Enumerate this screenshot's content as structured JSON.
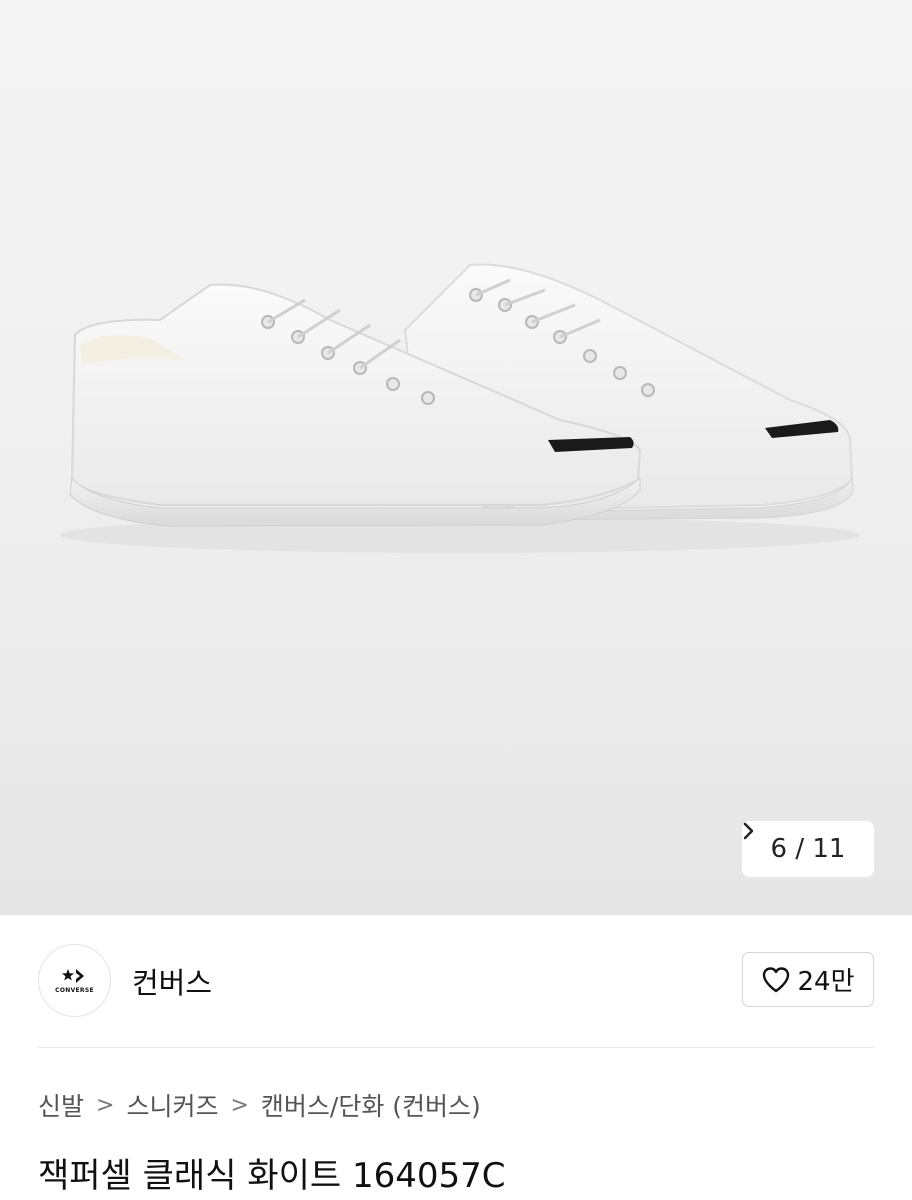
{
  "product_image": {
    "alt_icon": "sneakers-photo",
    "pager": {
      "current": "6",
      "separator": "/",
      "total": "11"
    }
  },
  "brand": {
    "logo_text": "CONVERSE",
    "name": "컨버스"
  },
  "like": {
    "count": "24만"
  },
  "breadcrumb": {
    "items": [
      "신발",
      "스니커즈",
      "캔버스/단화 (컨버스)"
    ]
  },
  "product": {
    "title": "잭퍼셀 클래식 화이트 164057C"
  }
}
